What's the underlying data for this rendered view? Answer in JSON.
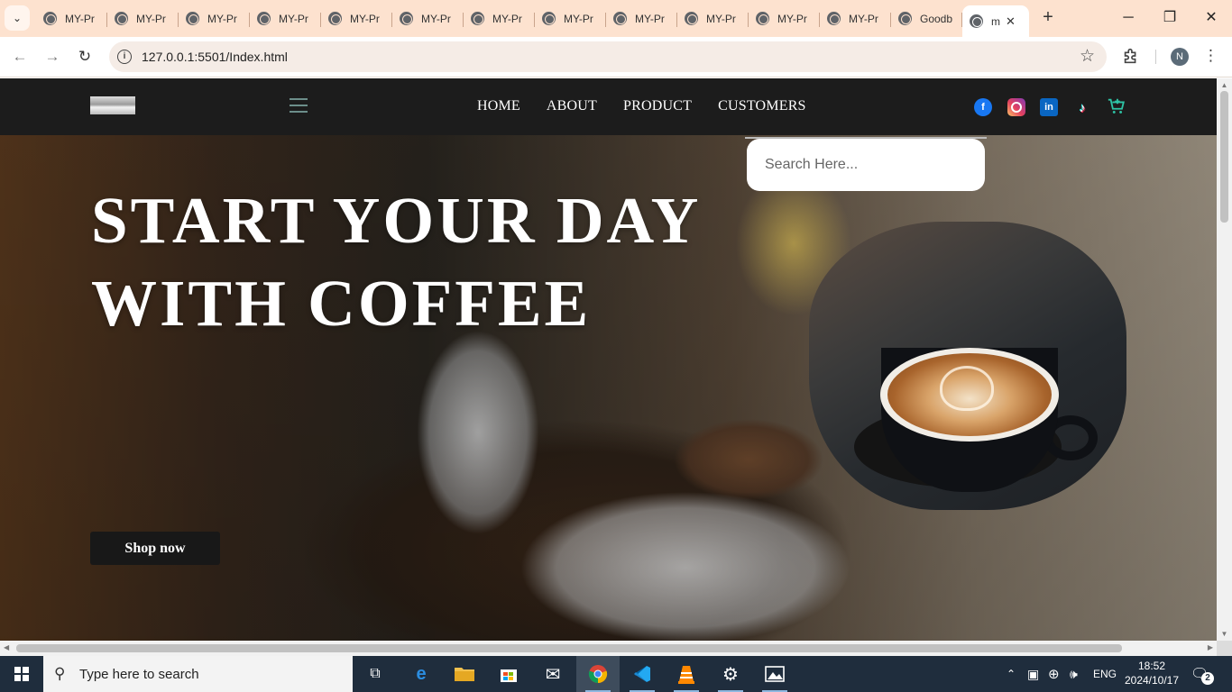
{
  "browser": {
    "tabs": [
      {
        "title": "MY-Pr"
      },
      {
        "title": "MY-Pr"
      },
      {
        "title": "MY-Pr"
      },
      {
        "title": "MY-Pr"
      },
      {
        "title": "MY-Pr"
      },
      {
        "title": "MY-Pr"
      },
      {
        "title": "MY-Pr"
      },
      {
        "title": "MY-Pr"
      },
      {
        "title": "MY-Pr"
      },
      {
        "title": "MY-Pr"
      },
      {
        "title": "MY-Pr"
      },
      {
        "title": "MY-Pr"
      },
      {
        "title": "Goodb"
      }
    ],
    "active_tab": {
      "title": "m",
      "close": "✕"
    },
    "new_tab": "+",
    "url": "127.0.0.1:5501/Index.html",
    "profile_initial": "N",
    "window_controls": {
      "minimize": "─",
      "restore": "❐",
      "close": "✕"
    }
  },
  "site": {
    "nav": {
      "links": [
        "HOME",
        "ABOUT",
        "PRODUCT",
        "CUSTOMERS"
      ]
    },
    "social": {
      "facebook": "f",
      "linkedin": "in",
      "tiktok": "♪"
    },
    "icons": [
      "facebook-icon",
      "instagram-icon",
      "linkedin-icon",
      "tiktok-icon",
      "cart-icon",
      "hamburger-menu-icon"
    ],
    "search": {
      "placeholder": "Search Here..."
    },
    "hero": {
      "line1": "START YOUR DAY",
      "line2": "WITH COFFEE",
      "cta": "Shop now"
    },
    "colors": {
      "nav_bg": "#1c1c1c",
      "cart_accent": "#2ec4a6",
      "button_bg": "#181818"
    }
  },
  "taskbar": {
    "search_placeholder": "Type here to search",
    "language": "ENG",
    "time": "18:52",
    "date": "2024/10/17",
    "notifications": "2"
  }
}
